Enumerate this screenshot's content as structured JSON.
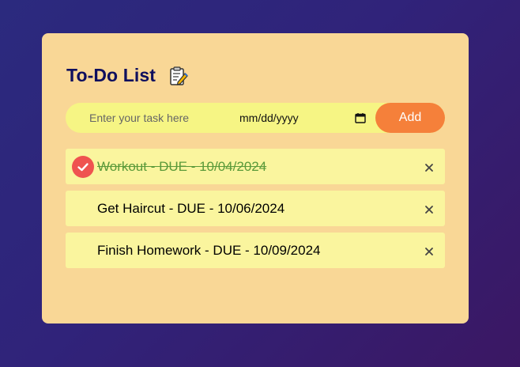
{
  "app": {
    "title": "To-Do List",
    "title_icon": "clipboard-edit-icon"
  },
  "form": {
    "task_placeholder": "Enter your task here",
    "date_placeholder": "mm/dd/yyyy",
    "date_icon": "calendar-icon",
    "add_label": "Add"
  },
  "tasks": [
    {
      "text": "Workout - DUE - 10/04/2024",
      "completed": true
    },
    {
      "text": "Get Haircut - DUE - 10/06/2024",
      "completed": false
    },
    {
      "text": "Finish Homework - DUE - 10/09/2024",
      "completed": false
    }
  ],
  "colors": {
    "background_start": "#2b2a7e",
    "background_end": "#3b1763",
    "card": "#f9d796",
    "input_bar": "#f6f584",
    "add_button": "#f5803a",
    "task_item": "#faf59e",
    "completed_text": "#5b9a3a",
    "check_circle": "#ef5350",
    "title": "#0f0f5e"
  }
}
